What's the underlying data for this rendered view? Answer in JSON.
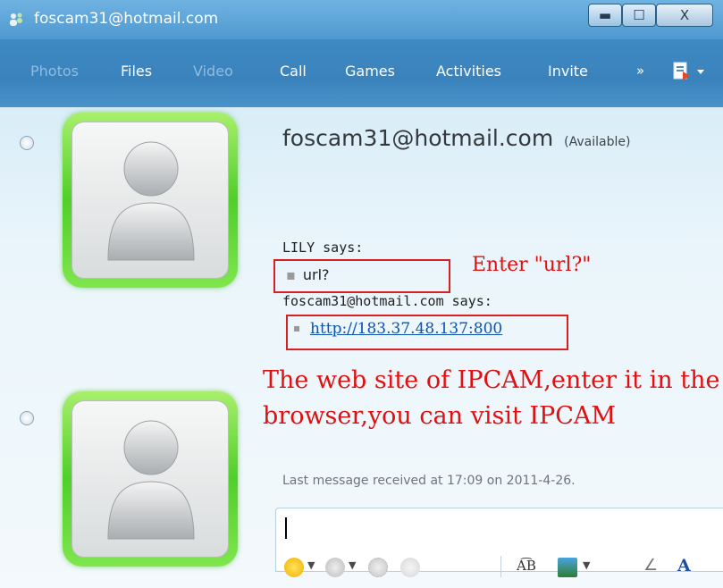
{
  "window": {
    "title": "foscam31@hotmail.com",
    "buttons": {
      "minimize": "▬",
      "maximize": "☐",
      "close": "X"
    }
  },
  "toolbar": {
    "items": [
      {
        "label": "Photos",
        "enabled": false
      },
      {
        "label": "Files",
        "enabled": true
      },
      {
        "label": "Video",
        "enabled": false
      },
      {
        "label": "Call",
        "enabled": true
      },
      {
        "label": "Games",
        "enabled": true
      },
      {
        "label": "Activities",
        "enabled": true
      },
      {
        "label": "Invite",
        "enabled": true
      }
    ],
    "more": "»"
  },
  "contact": {
    "name": "foscam31@hotmail.com",
    "status": "(Available)"
  },
  "conversation": {
    "lily_says": "LILY says:",
    "lily_message": "url?",
    "foscam_says": "foscam31@hotmail.com says:",
    "foscam_message": "http://183.37.48.137:800"
  },
  "annotations": {
    "enter_url": "Enter \"url?\"",
    "web_site_line1": "The web site of  IPCAM,enter it in the",
    "web_site_line2": "browser,you can visit IPCAM"
  },
  "last_message": "Last message received at 17:09 on 2011-4-26.",
  "input": {
    "value": ""
  },
  "colors": {
    "titlebar": "#5aa2d8",
    "toolbar": "#3d87c0",
    "annotation_red": "#e01010",
    "link_blue": "#0a52b4",
    "avatar_green": "#5fd634"
  },
  "icons": [
    "msn-people-icon",
    "emoticon-icon",
    "wink-icon",
    "nudge-icon",
    "voice-clip-icon",
    "font-icon",
    "background-icon",
    "pen-icon",
    "text-format-icon"
  ]
}
